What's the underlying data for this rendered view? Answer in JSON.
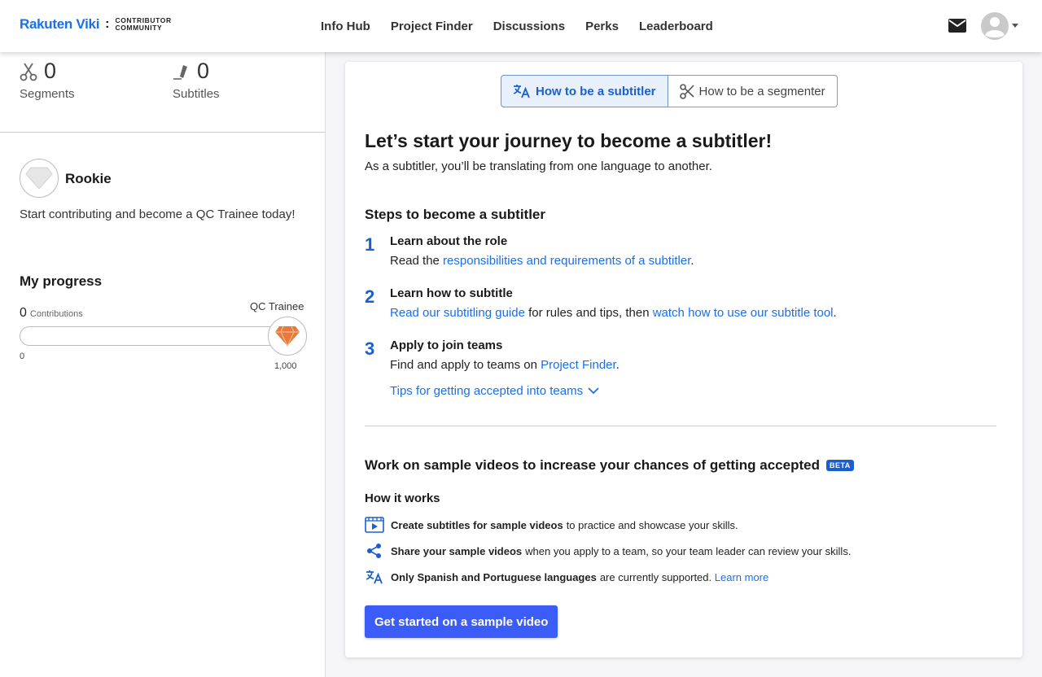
{
  "header": {
    "brand": "Rakuten Viki",
    "separator": ":",
    "community_line1": "CONTRIBUTOR",
    "community_line2": "COMMUNITY",
    "nav": [
      "Info Hub",
      "Project Finder",
      "Discussions",
      "Perks",
      "Leaderboard"
    ],
    "icons": {
      "mail": "mail-icon",
      "avatar": "user-avatar-icon",
      "caret": "chevron-down-icon"
    }
  },
  "sidebar": {
    "segments": {
      "count": "0",
      "label": "Segments",
      "icon": "scissors-icon"
    },
    "subtitles": {
      "count": "0",
      "label": "Subtitles",
      "icon": "pen-icon"
    },
    "rank": {
      "name": "Rookie",
      "description": "Start contributing and become a QC Trainee today!"
    },
    "progress": {
      "title": "My progress",
      "count": "0",
      "count_label": "Contributions",
      "target_label": "QC Trainee",
      "min": "0",
      "max": "1,000",
      "fraction": 0
    }
  },
  "main": {
    "tabs": [
      {
        "label": "How to be a subtitler",
        "icon": "translate-icon",
        "active": true
      },
      {
        "label": "How to be a segmenter",
        "icon": "scissors-icon",
        "active": false
      }
    ],
    "title": "Let’s start your journey to become a subtitler!",
    "intro": "As a subtitler, you’ll be translating from one language to another.",
    "steps_title": "Steps to become a subtitler",
    "steps": [
      {
        "num": "1",
        "title": "Learn about the role",
        "pre": "Read the ",
        "link": "responsibilities and requirements of a subtitler",
        "post": "."
      },
      {
        "num": "2",
        "title": "Learn how to subtitle",
        "link1": "Read our subtitling guide",
        "mid": " for rules and tips, then ",
        "link2": "watch how to use our subtitle tool",
        "post": "."
      },
      {
        "num": "3",
        "title": "Apply to join teams",
        "pre": "Find and apply to teams on ",
        "link": "Project Finder",
        "post": "."
      }
    ],
    "tips_label": "Tips for getting accepted into teams",
    "sample_title": "Work on sample videos to increase your chances of getting accepted",
    "beta": "BETA",
    "how_title": "How it works",
    "how_items": [
      {
        "icon": "video-icon",
        "bold": "Create subtitles for sample videos",
        "text": "to practice and showcase your skills."
      },
      {
        "icon": "share-icon",
        "bold": "Share your sample videos",
        "text": "when you apply to a team, so your team leader can review your skills."
      },
      {
        "icon": "translate-icon",
        "bold": "Only Spanish and Portuguese languages",
        "text": "are currently supported.",
        "link": "Learn more"
      }
    ],
    "cta": "Get started on a sample video"
  },
  "colors": {
    "accent": "#1b6fe8",
    "cta": "#3b5cf6",
    "gem": "#e8793c"
  }
}
